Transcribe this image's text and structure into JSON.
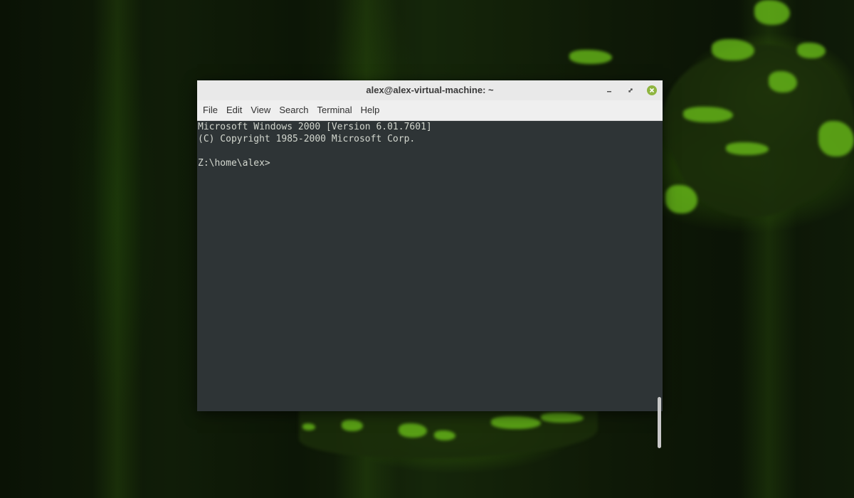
{
  "window": {
    "title": "alex@alex-virtual-machine: ~"
  },
  "menu": {
    "items": [
      "File",
      "Edit",
      "View",
      "Search",
      "Terminal",
      "Help"
    ]
  },
  "terminal": {
    "lines": [
      "Microsoft Windows 2000 [Version 6.01.7601]",
      "(C) Copyright 1985-2000 Microsoft Corp.",
      "",
      "Z:\\home\\alex>"
    ]
  },
  "colors": {
    "terminal_background": "#2e3436",
    "terminal_foreground": "#d3d7cf",
    "close_button": "#8fb540",
    "titlebar": "#e9e9e9"
  },
  "icons": {
    "minimize": "minimize-icon",
    "maximize": "maximize-icon",
    "close": "close-icon"
  }
}
